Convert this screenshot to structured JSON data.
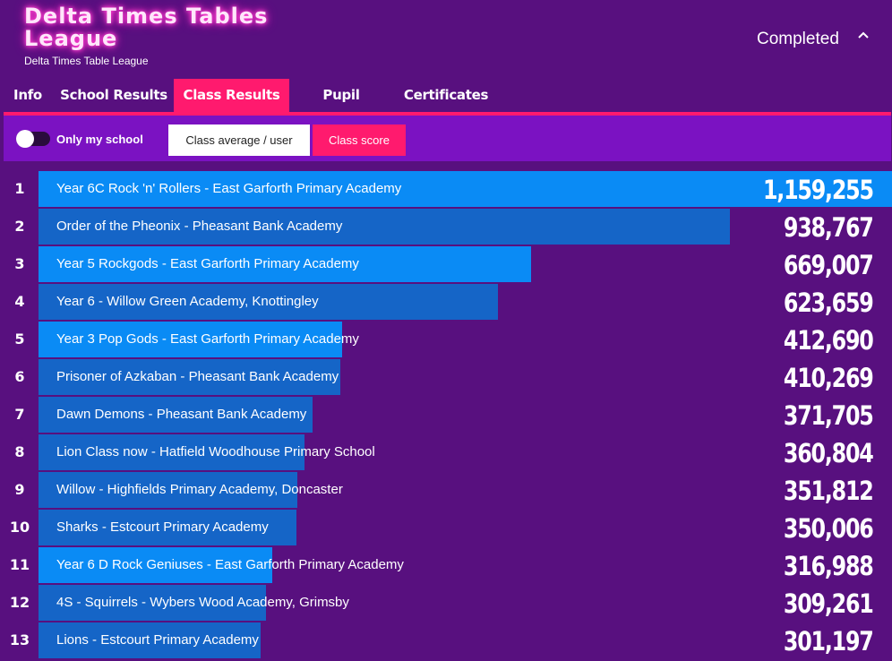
{
  "header": {
    "title": "Delta Times Tables League",
    "subtitle": "Delta Times Table League",
    "status": "Completed",
    "status_icon": "chevron-up-icon"
  },
  "tabs": [
    {
      "label": "Info",
      "active": false
    },
    {
      "label": "School Results",
      "active": false
    },
    {
      "label": "Class Results",
      "active": true
    },
    {
      "label": "Pupil Results",
      "active": false
    },
    {
      "label": "Certificates",
      "active": false
    }
  ],
  "toolbar": {
    "toggle_label": "Only my school",
    "toggle_on": false,
    "class_average_label": "Class average / user",
    "class_score_label": "Class score",
    "selected": "Class score"
  },
  "colors": {
    "background": "#58107f",
    "accent": "#ff1a6e",
    "toolbar": "#7b12c2",
    "bar_light": "#0a8bf5",
    "bar_dark": "#1565c7"
  },
  "rows": [
    {
      "rank": "1",
      "name": "Year 6C Rock 'n' Rollers - East Garforth Primary Academy",
      "score": "1,159,255",
      "value": 1159255,
      "shade": "light"
    },
    {
      "rank": "2",
      "name": "Order of the Pheonix - Pheasant Bank Academy",
      "score": "938,767",
      "value": 938767,
      "shade": "dark"
    },
    {
      "rank": "3",
      "name": "Year 5 Rockgods - East Garforth Primary Academy",
      "score": "669,007",
      "value": 669007,
      "shade": "light"
    },
    {
      "rank": "4",
      "name": "Year 6 - Willow Green Academy, Knottingley",
      "score": "623,659",
      "value": 623659,
      "shade": "dark"
    },
    {
      "rank": "5",
      "name": "Year 3 Pop Gods - East Garforth Primary Academy",
      "score": "412,690",
      "value": 412690,
      "shade": "light"
    },
    {
      "rank": "6",
      "name": "Prisoner of Azkaban - Pheasant Bank Academy",
      "score": "410,269",
      "value": 410269,
      "shade": "dark"
    },
    {
      "rank": "7",
      "name": "Dawn Demons - Pheasant Bank Academy",
      "score": "371,705",
      "value": 371705,
      "shade": "dark"
    },
    {
      "rank": "8",
      "name": "Lion Class now - Hatfield Woodhouse Primary School",
      "score": "360,804",
      "value": 360804,
      "shade": "dark"
    },
    {
      "rank": "9",
      "name": "Willow - Highfields Primary Academy, Doncaster",
      "score": "351,812",
      "value": 351812,
      "shade": "dark"
    },
    {
      "rank": "10",
      "name": "Sharks - Estcourt Primary Academy",
      "score": "350,006",
      "value": 350006,
      "shade": "dark"
    },
    {
      "rank": "11",
      "name": "Year 6 D Rock Geniuses - East Garforth Primary Academy",
      "score": "316,988",
      "value": 316988,
      "shade": "light"
    },
    {
      "rank": "12",
      "name": "4S - Squirrels - Wybers Wood Academy, Grimsby",
      "score": "309,261",
      "value": 309261,
      "shade": "dark"
    },
    {
      "rank": "13",
      "name": "Lions - Estcourt Primary Academy",
      "score": "301,197",
      "value": 301197,
      "shade": "dark"
    }
  ]
}
